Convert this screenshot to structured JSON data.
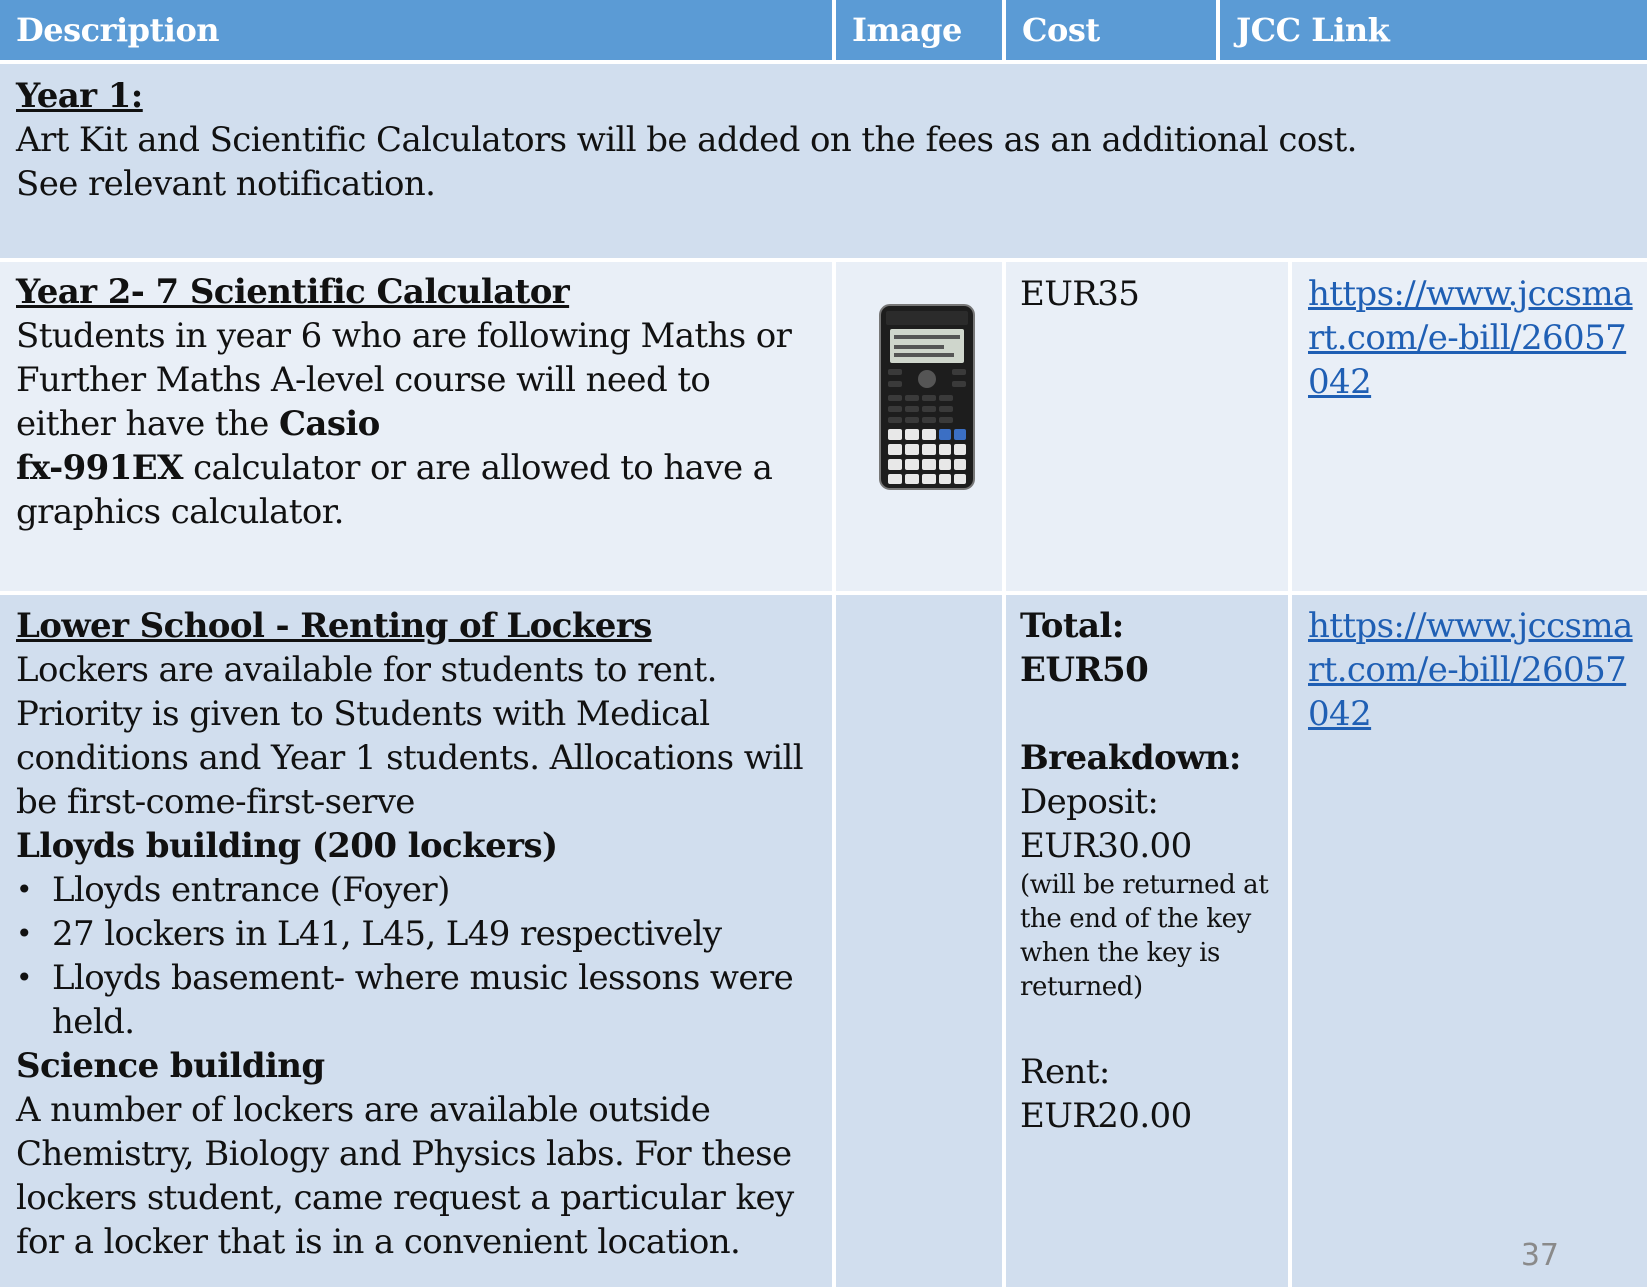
{
  "header": {
    "description": "Description",
    "image": "Image",
    "cost": "Cost",
    "link": "JCC Link"
  },
  "year1": {
    "title": "Year 1:",
    "line1": "Art Kit and Scientific Calculators will be added on the fees as an additional cost.",
    "line2": "See relevant notification."
  },
  "calculator": {
    "title": "Year 2- 7 Scientific Calculator",
    "text1": "Students in year 6 who are following Maths or Further Maths A-level course will need to either have the ",
    "bold1": "Casio",
    "bold2": "fx-991EX",
    "text2": " calculator or are allowed to have a graphics calculator.",
    "cost": "EUR35",
    "link": "https://www.jccsmart.com/e-bill/26057042",
    "image_icon": "casio-calculator-image"
  },
  "lockers": {
    "title": "Lower School - Renting of Lockers",
    "intro": "Lockers are available for students to rent. Priority is given to Students with Medical conditions and Year 1 students. Allocations will be first-come-first-serve",
    "lloyds_heading": "Lloyds building (200 lockers)",
    "lloyds_items": [
      "Lloyds entrance (Foyer)",
      "27 lockers in L41, L45, L49 respectively",
      "Lloyds basement- where music lessons were held."
    ],
    "science_heading": "Science building",
    "science_text": "A number of lockers are available outside Chemistry, Biology and Physics labs.  For these lockers student, came request a particular key for a locker that is in a convenient location.",
    "cost_total_label": "Total:",
    "cost_total": "EUR50",
    "breakdown_label": "Breakdown:",
    "deposit_label": "Deposit:",
    "deposit": "EUR30.00",
    "deposit_note": "(will be returned at the end of the key when the key is returned)",
    "rent_label": "Rent:",
    "rent": "EUR20.00",
    "link": "https://www.jccsmart.com/e-bill/26057042"
  },
  "page_number": "37",
  "colors": {
    "header_bg": "#5b9bd5",
    "row_dark": "#d1deee",
    "row_light": "#e9eff7",
    "link": "#1f5fb4"
  }
}
